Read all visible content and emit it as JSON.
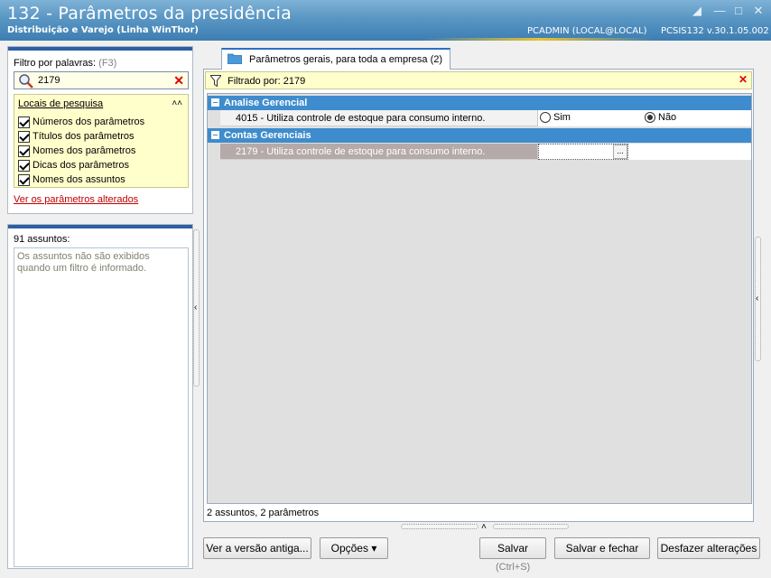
{
  "window": {
    "title": "132 - Parâmetros da presidência",
    "subtitle": "Distribuição e Varejo (Linha WinThor)",
    "user": "PCADMIN (LOCAL@LOCAL)",
    "version": "PCSIS132  v.30.1.05.002"
  },
  "filter": {
    "label": "Filtro por palavras:",
    "hotkey": "(F3)",
    "value": "2179",
    "locais_title": "Locais de pesquisa",
    "options": [
      {
        "label": "Números dos parâmetros",
        "checked": true
      },
      {
        "label": "Títulos dos parâmetros",
        "checked": true
      },
      {
        "label": "Nomes dos parâmetros",
        "checked": true
      },
      {
        "label": "Dicas dos parâmetros",
        "checked": true
      },
      {
        "label": "Nomes dos assuntos",
        "checked": true
      }
    ],
    "changed_link": "Ver os parâmetros alterados"
  },
  "assuntos": {
    "count_label": "91 assuntos:",
    "message": "Os assuntos não são exibidos quando um filtro é informado."
  },
  "tab": {
    "label": "Parâmetros gerais, para toda a empresa",
    "count": "(2)"
  },
  "filtered_bar": {
    "text": "Filtrado por: 2179"
  },
  "groups": [
    {
      "title": "Analise Gerencial",
      "rows": [
        {
          "label": "4015 - Utiliza controle de estoque para consumo interno.",
          "options": [
            "Sim",
            "Não"
          ],
          "selected": "Não"
        }
      ]
    },
    {
      "title": "Contas Gerenciais",
      "rows": [
        {
          "label": "2179 - Utiliza controle de estoque para consumo interno.",
          "value": "",
          "ellipsis": "..."
        }
      ]
    }
  ],
  "status": "2 assuntos, 2 parâmetros",
  "buttons": {
    "old_version": "Ver a versão antiga...",
    "options": "Opções",
    "save": "Salvar",
    "save_shortcut": "(Ctrl+S)",
    "save_close": "Salvar e fechar",
    "undo": "Desfazer alterações"
  }
}
